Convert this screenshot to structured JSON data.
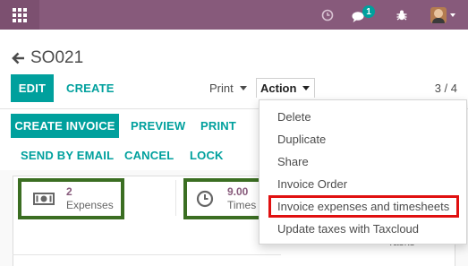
{
  "navbar": {
    "activity_icon": "clock-icon",
    "messages_icon": "chat-bubbles-icon",
    "messages_badge": "1",
    "debug_icon": "bug-icon",
    "avatar_icon": "user-avatar",
    "colors": {
      "navbar": "#875a7b",
      "accent": "#00a09d"
    }
  },
  "breadcrumb": {
    "title": "SO021"
  },
  "toolbar": {
    "edit_label": "EDIT",
    "create_label": "CREATE",
    "print_label": "Print",
    "action_label": "Action",
    "pager": "3 / 4"
  },
  "status_buttons": {
    "create_invoice": "CREATE INVOICE",
    "preview": "PREVIEW",
    "print": "PRINT",
    "send_by_email": "SEND BY EMAIL",
    "cancel": "CANCEL",
    "lock": "LOCK"
  },
  "smart_buttons": {
    "expenses": {
      "value": "2",
      "label": "Expenses",
      "icon": "money-icon"
    },
    "timesheets": {
      "value": "9.00",
      "label": "Times",
      "icon": "clock-icon"
    },
    "tasks": {
      "label": "Tasks"
    }
  },
  "action_menu": {
    "items": [
      "Delete",
      "Duplicate",
      "Share",
      "Invoice Order",
      "Invoice expenses and timesheets",
      "Update taxes with Taxcloud"
    ],
    "highlighted_index": 4
  }
}
